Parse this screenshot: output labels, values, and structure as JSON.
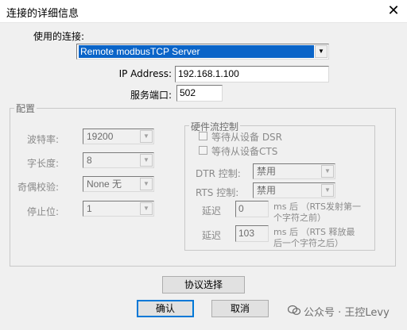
{
  "window": {
    "title": "连接的详细信息"
  },
  "connection": {
    "label": "使用的连接:",
    "selected": "Remote modbusTCP Server"
  },
  "ip": {
    "label": "IP Address:",
    "value": "192.168.1.100"
  },
  "port": {
    "label": "服务端口:",
    "value": "502"
  },
  "config": {
    "title": "配置",
    "baud_label": "波特率:",
    "baud_value": "19200",
    "databits_label": "字长度:",
    "databits_value": "8",
    "parity_label": "奇偶校验:",
    "parity_value": "None 无",
    "stopbits_label": "停止位:",
    "stopbits_value": "1"
  },
  "flow": {
    "title": "硬件流控制",
    "dsr_label": "等待从设备 DSR",
    "cts_label": "等待从设备CTS",
    "dtr_label": "DTR 控制:",
    "dtr_value": "禁用",
    "rts_label": "RTS 控制:",
    "rts_value": "禁用",
    "delay1_label": "延迟",
    "delay1_value": "0",
    "delay1_note_1": "ms 后 （RTS发射第一",
    "delay1_note_2": "个字符之前）",
    "delay2_label": "延迟",
    "delay2_value": "103",
    "delay2_note_1": "ms 后 （RTS 释放最",
    "delay2_note_2": "后一个字符之后）"
  },
  "buttons": {
    "protocol": "协议选择",
    "ok": "确认",
    "cancel": "取消"
  },
  "watermark": {
    "text": "公众号 · 王控Levy"
  }
}
